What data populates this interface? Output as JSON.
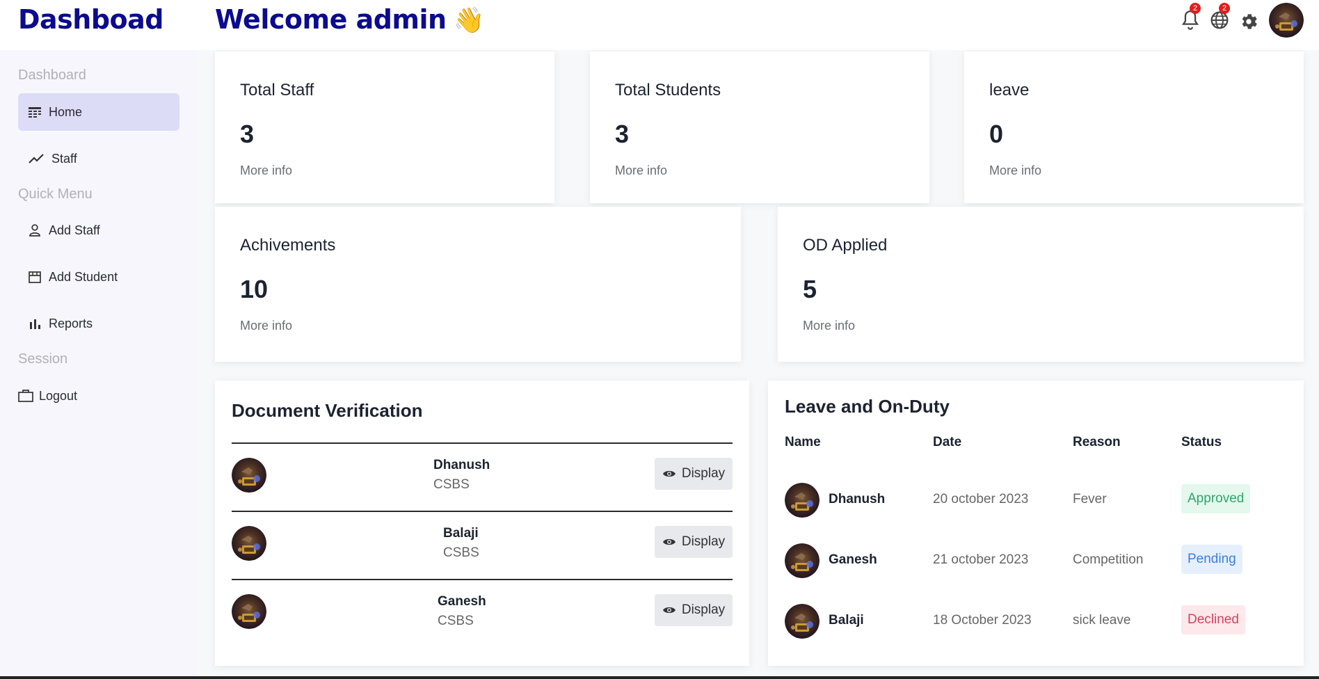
{
  "header": {
    "brand": "Dashboad",
    "welcome": "Welcome admin",
    "wave_emoji": "👋",
    "notifications_count": "2",
    "globe_count": "2"
  },
  "sidebar": {
    "sections": [
      {
        "title": "Dashboard"
      },
      {
        "title": "Quick Menu"
      },
      {
        "title": "Session"
      }
    ],
    "items": [
      {
        "label": "Home",
        "icon": "home-grid-icon"
      },
      {
        "label": "Staff",
        "icon": "trend-icon"
      },
      {
        "label": "Add Staff",
        "icon": "user-icon"
      },
      {
        "label": "Add Student",
        "icon": "store-icon"
      },
      {
        "label": "Reports",
        "icon": "bar-chart-icon"
      },
      {
        "label": "Logout",
        "icon": "briefcase-icon"
      }
    ]
  },
  "stats": [
    {
      "title": "Total Staff",
      "value": "3",
      "more": "More info"
    },
    {
      "title": "Total Students",
      "value": "3",
      "more": "More info"
    },
    {
      "title": "leave",
      "value": "0",
      "more": "More info"
    },
    {
      "title": "Achivements",
      "value": "10",
      "more": "More info"
    },
    {
      "title": "OD Applied",
      "value": "5",
      "more": "More info"
    }
  ],
  "documents": {
    "title": "Document Verification",
    "button_label": "Display",
    "rows": [
      {
        "name": "Dhanush",
        "dept": "CSBS"
      },
      {
        "name": "Balaji",
        "dept": "CSBS"
      },
      {
        "name": "Ganesh",
        "dept": "CSBS"
      }
    ]
  },
  "leave": {
    "title": "Leave and On-Duty",
    "headers": [
      "Name",
      "Date",
      "Reason",
      "Status"
    ],
    "rows": [
      {
        "name": "Dhanush",
        "date": "20 october 2023",
        "reason": "Fever",
        "status": "Approved"
      },
      {
        "name": "Ganesh",
        "date": "21 october 2023",
        "reason": "Competition",
        "status": "Pending"
      },
      {
        "name": "Balaji",
        "date": "18 October 2023",
        "reason": "sick leave",
        "status": "Declined"
      }
    ]
  },
  "colors": {
    "brand": "#0b0b8f",
    "active_nav": "#dcdcf7",
    "badge": "#e11d1d",
    "approved": "#2fa56a",
    "pending": "#3a7de0",
    "declined": "#d2435c"
  }
}
